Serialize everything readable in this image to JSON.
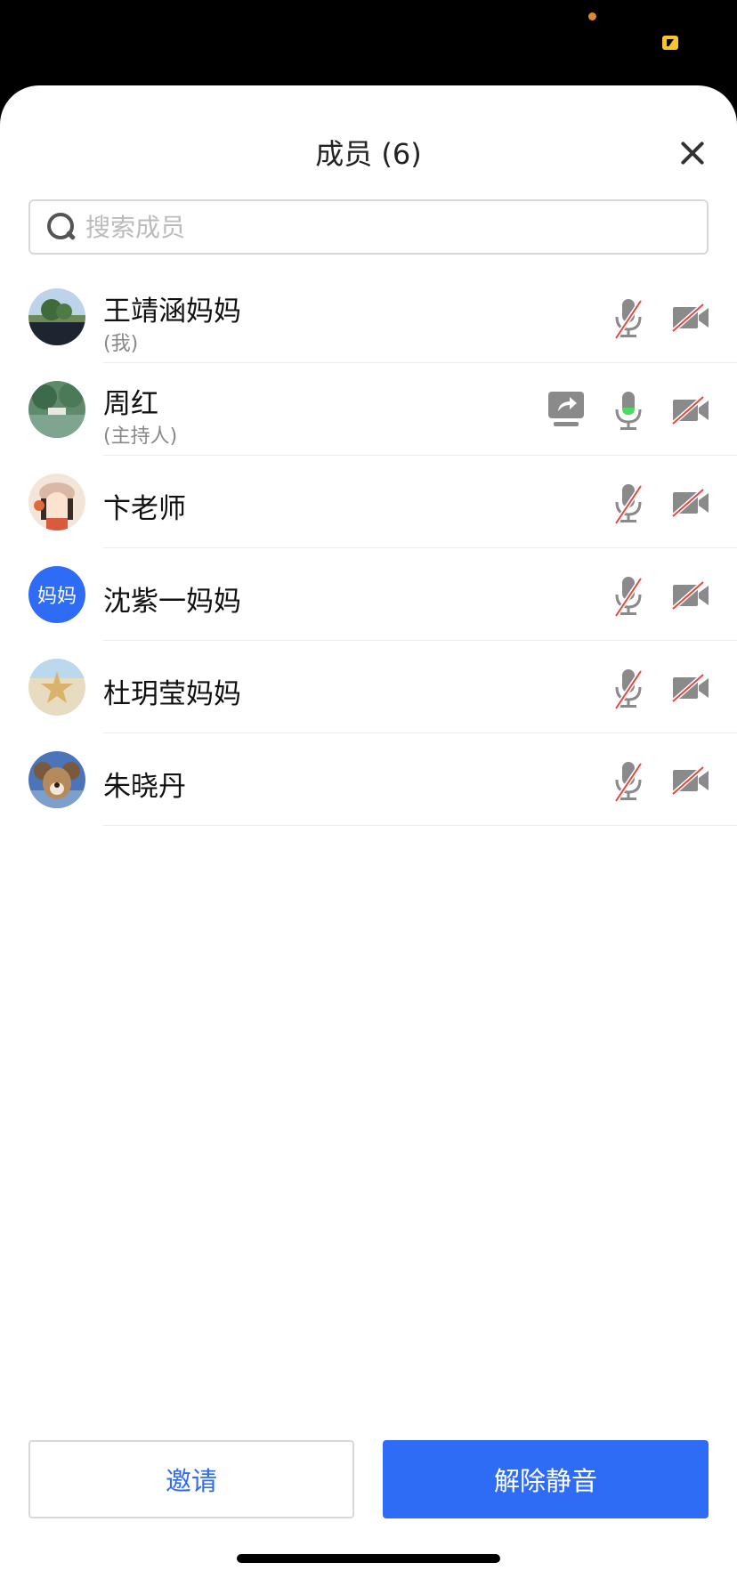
{
  "header": {
    "title": "成员 (6)"
  },
  "search": {
    "placeholder": "搜索成员"
  },
  "members": [
    {
      "name": "王靖涵妈妈",
      "role": "(我)",
      "mic": "muted",
      "camera": "off",
      "sharing": false,
      "avatar": "image"
    },
    {
      "name": "周红",
      "role": "(主持人)",
      "mic": "on",
      "camera": "off",
      "sharing": true,
      "avatar": "image"
    },
    {
      "name": "卞老师",
      "role": "",
      "mic": "muted",
      "camera": "off",
      "sharing": false,
      "avatar": "image"
    },
    {
      "name": "沈紫一妈妈",
      "role": "",
      "mic": "muted",
      "camera": "off",
      "sharing": false,
      "avatar_text": "妈妈"
    },
    {
      "name": "杜玥莹妈妈",
      "role": "",
      "mic": "muted",
      "camera": "off",
      "sharing": false,
      "avatar": "image"
    },
    {
      "name": "朱晓丹",
      "role": "",
      "mic": "muted",
      "camera": "off",
      "sharing": false,
      "avatar": "image"
    }
  ],
  "footer": {
    "invite_label": "邀请",
    "unmute_label": "解除静音"
  },
  "colors": {
    "accent": "#2f6cf6",
    "mic_active": "#4cd964",
    "muted_slash": "#e8453c",
    "icon_gray": "#8a8a8a"
  },
  "icons": {
    "mic_muted": "mic-muted-icon",
    "mic_on": "mic-icon",
    "camera_off": "camera-off-icon",
    "screen_share": "screen-share-icon",
    "close": "close-icon",
    "search": "search-icon"
  }
}
